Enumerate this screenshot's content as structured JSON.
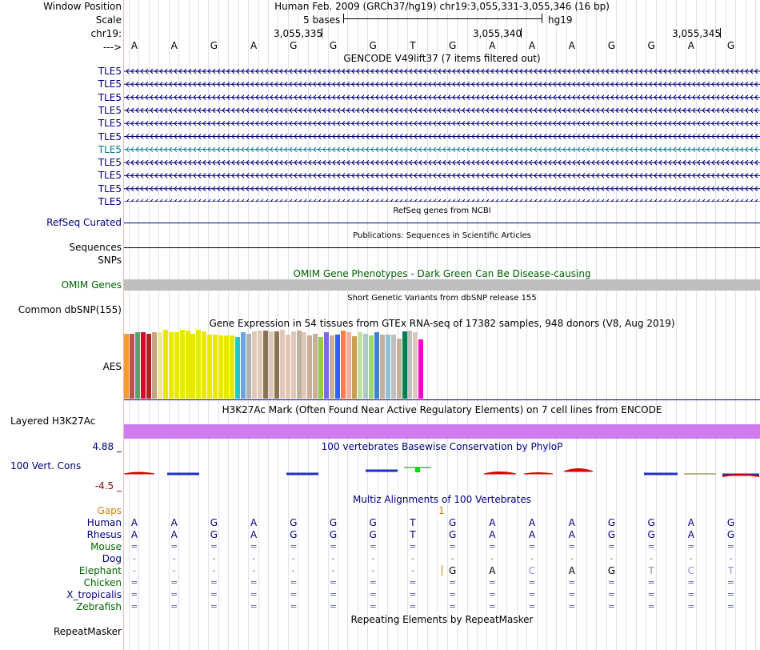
{
  "header": {
    "window_position_label": "Window Position",
    "scale_label": "Scale",
    "chrom_label": "chr19:",
    "strand_label": "--->",
    "title": "Human Feb. 2009 (GRCh37/hg19)   chr19:3,055,331-3,055,346 (16 bp)",
    "scale_text": "5 bases",
    "assembly": "hg19",
    "positions": [
      "3,055,335",
      "3,055,340",
      "3,055,345"
    ]
  },
  "sequence": [
    "A",
    "A",
    "G",
    "A",
    "G",
    "G",
    "G",
    "T",
    "G",
    "A",
    "A",
    "A",
    "G",
    "G",
    "A",
    "G"
  ],
  "gencode": {
    "title": "GENCODE V49lift37 (7 items filtered out)",
    "label_text": "TLE5",
    "rows": [
      {
        "color": "#000080"
      },
      {
        "color": "#000080"
      },
      {
        "color": "#000080"
      },
      {
        "color": "#000080"
      },
      {
        "color": "#000080"
      },
      {
        "color": "#000080"
      },
      {
        "color": "#0c7a90"
      },
      {
        "color": "#000080"
      },
      {
        "color": "#000080"
      },
      {
        "color": "#000080"
      },
      {
        "color": "#000080"
      }
    ]
  },
  "refseq": {
    "label": "RefSeq Curated",
    "title": "RefSeq genes from NCBI"
  },
  "publications": {
    "label": "Sequences",
    "title": "Publications: Sequences in Scientific Articles"
  },
  "snps": {
    "label": "SNPs"
  },
  "omim": {
    "label": "OMIM Genes",
    "title": "OMIM Gene Phenotypes - Dark Green Can Be Disease-causing"
  },
  "dbsnp": {
    "label": "Common dbSNP(155)",
    "title": "Short Genetic Variants from dbSNP release 155"
  },
  "gtex": {
    "label": "AES",
    "title": "Gene Expression in 54 tissues from GTEx RNA-seq of 17382 samples, 948 donors (V8, Aug 2019)",
    "levels": [
      0.94,
      0.94,
      0.96,
      0.96,
      0.94,
      0.96,
      0.96,
      1.0,
      0.96,
      0.96,
      1.0,
      0.99,
      0.94,
      1.0,
      0.98,
      0.93,
      0.93,
      0.92,
      0.92,
      0.92,
      0.9,
      0.96,
      0.94,
      0.98,
      0.99,
      0.99,
      0.98,
      0.98,
      1.0,
      0.93,
      0.98,
      0.99,
      0.96,
      0.92,
      0.94,
      0.9,
      0.96,
      0.92,
      0.93,
      0.99,
      0.97,
      0.91,
      0.96,
      0.94,
      0.92,
      0.96,
      0.93,
      0.93,
      0.93,
      0.87,
      0.98,
      0.99,
      0.97,
      0.86
    ],
    "colors": [
      "#f39c31",
      "#c0504d",
      "#5aa469",
      "#c8102e",
      "#b22222",
      "#c4a484",
      "#f0e68c",
      "#e8e800",
      "#e8e800",
      "#e8e800",
      "#e8e800",
      "#e8e800",
      "#e8e800",
      "#e8e800",
      "#e8e800",
      "#e8e800",
      "#e8e800",
      "#e8e800",
      "#e8e800",
      "#e8e800",
      "#22c8c8",
      "#6aa5e0",
      "#b0b0b0",
      "#e0c8b8",
      "#e0c8b8",
      "#8b7355",
      "#e0c8b8",
      "#8b7355",
      "#e0c8b8",
      "#e0c8b8",
      "#e0c8b8",
      "#c0b0a0",
      "#e0c8b8",
      "#c8b098",
      "#c8b098",
      "#9acd32",
      "#7b68ee",
      "#c8b098",
      "#3060ff",
      "#ff8040",
      "#f0b0a0",
      "#c8a050",
      "#c0e0a0",
      "#b0c8c8",
      "#98d870",
      "#4080d0",
      "#c0b0a0",
      "#90c0d8",
      "#c0c0c0",
      "#c8b098",
      "#008050",
      "#c0c0c0",
      "#e0c8b8",
      "#ff00cc"
    ]
  },
  "h3k27ac": {
    "label": "Layered H3K27Ac",
    "title": "H3K27Ac Mark (Often Found Near Active Regulatory Elements) on 7 cell lines from ENCODE",
    "fill": "#d07cf0"
  },
  "conservation": {
    "label": "100 Vert. Cons",
    "max_label": "4.88 _",
    "min_label": "-4.5 _",
    "title": "100 vertebrates Basewise Conservation by PhyloP"
  },
  "multiz": {
    "title": "Multiz Alignments of 100 Vertebrates",
    "gaps_label": "Gaps",
    "gap_marker": "1",
    "species": [
      {
        "name": "Human",
        "color": "#000080",
        "row": [
          "A",
          "A",
          "G",
          "A",
          "G",
          "G",
          "G",
          "T",
          "G",
          "A",
          "A",
          "A",
          "G",
          "G",
          "A",
          "G"
        ]
      },
      {
        "name": "Rhesus",
        "color": "#000080",
        "row": [
          "A",
          "A",
          "G",
          "A",
          "G",
          "G",
          "G",
          "T",
          "G",
          "A",
          "A",
          "A",
          "G",
          "G",
          "A",
          "G"
        ]
      },
      {
        "name": "Mouse",
        "color": "#006400",
        "row": [
          "=",
          "=",
          "=",
          "=",
          "=",
          "=",
          "=",
          "=",
          "=",
          "=",
          "=",
          "=",
          "=",
          "=",
          "=",
          "="
        ]
      },
      {
        "name": "Dog",
        "color": "#000080",
        "row": [
          "-",
          "-",
          "-",
          "-",
          "-",
          "-",
          "-",
          "-",
          "-",
          "-",
          "-",
          "-",
          "-",
          "-",
          "-",
          "-"
        ]
      },
      {
        "name": "Elephant",
        "color": "#006400",
        "row": [
          "-",
          "-",
          "-",
          "-",
          "-",
          "-",
          "-",
          "-",
          "G",
          "A",
          "C",
          "A",
          "G",
          "T",
          "C",
          "T"
        ]
      },
      {
        "name": "Chicken",
        "color": "#006400",
        "row": [
          "=",
          "=",
          "=",
          "=",
          "=",
          "=",
          "=",
          "=",
          "=",
          "=",
          "=",
          "=",
          "=",
          "=",
          "=",
          "="
        ]
      },
      {
        "name": "X_tropicalis",
        "color": "#000080",
        "row": [
          "=",
          "=",
          "=",
          "=",
          "=",
          "=",
          "=",
          "=",
          "=",
          "=",
          "=",
          "=",
          "=",
          "=",
          "=",
          "="
        ]
      },
      {
        "name": "Zebrafish",
        "color": "#006400",
        "row": [
          "=",
          "=",
          "=",
          "=",
          "=",
          "=",
          "=",
          "=",
          "=",
          "=",
          "=",
          "=",
          "=",
          "=",
          "=",
          "="
        ]
      }
    ]
  },
  "repeatmasker": {
    "label": "RepeatMasker",
    "title": "Repeating Elements by RepeatMasker"
  }
}
